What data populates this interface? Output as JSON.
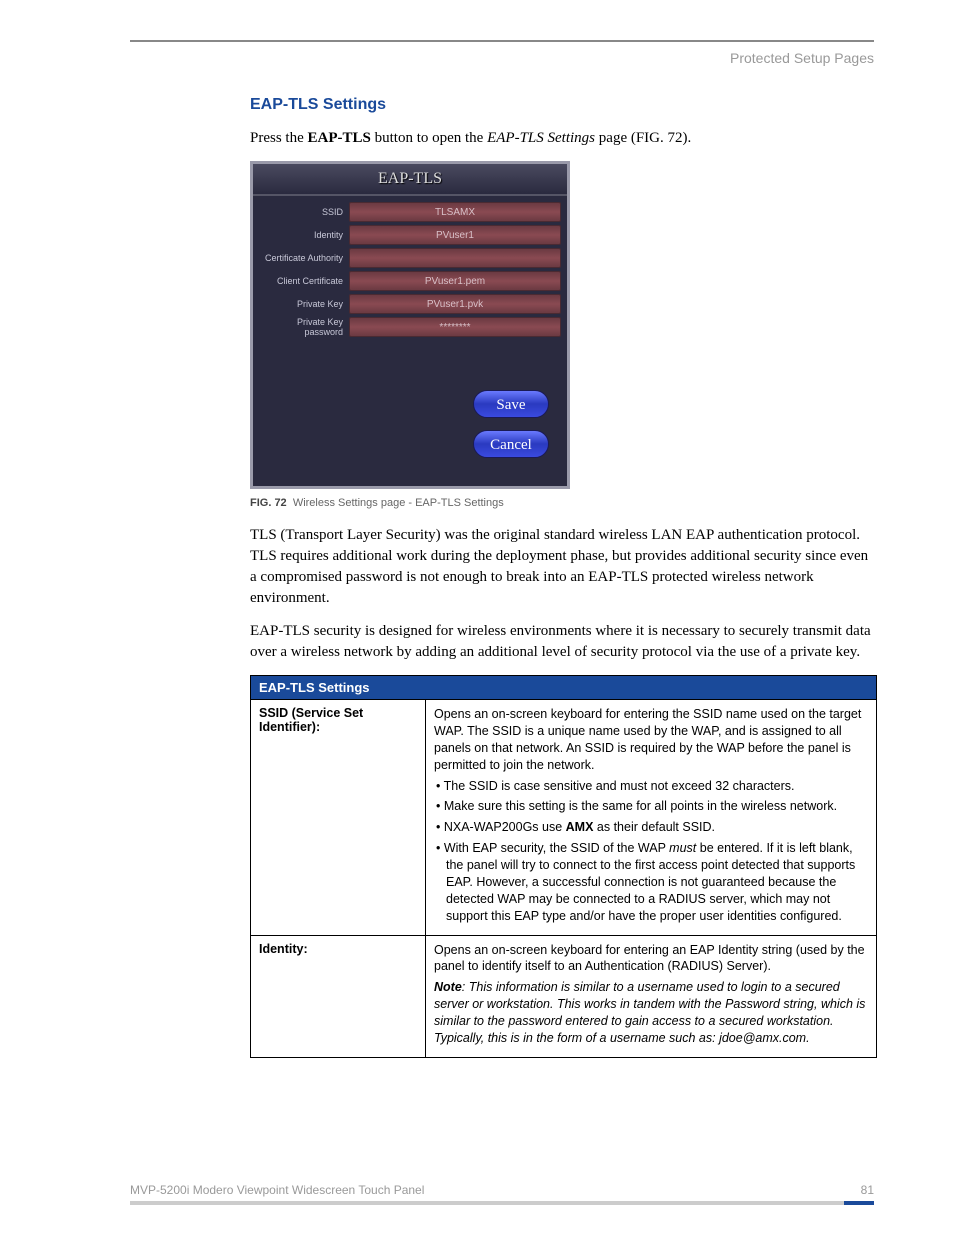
{
  "header": {
    "section": "Protected Setup Pages"
  },
  "section_title": "EAP-TLS Settings",
  "intro": {
    "prefix": "Press the ",
    "bold": "EAP-TLS",
    "mid": " button to open the ",
    "italic": "EAP-TLS Settings",
    "suffix": " page (FIG. 72)."
  },
  "ui": {
    "title": "EAP-TLS",
    "rows": [
      {
        "label": "SSID",
        "value": "TLSAMX"
      },
      {
        "label": "Identity",
        "value": "PVuser1"
      },
      {
        "label": "Certificate Authority",
        "value": ""
      },
      {
        "label": "Client Certificate",
        "value": "PVuser1.pem"
      },
      {
        "label": "Private Key",
        "value": "PVuser1.pvk"
      },
      {
        "label": "Private Key password",
        "value": "********"
      }
    ],
    "save": "Save",
    "cancel": "Cancel"
  },
  "fig": {
    "num": "FIG. 72",
    "caption": "Wireless Settings page - EAP-TLS Settings"
  },
  "para1": "TLS (Transport Layer Security) was the original standard wireless LAN EAP authentication protocol. TLS requires additional work during the deployment phase, but provides additional security since even a compromised password is not enough to break into an EAP-TLS protected wireless network environment.",
  "para2": "EAP-TLS security is designed for wireless environments where it is necessary to securely transmit data over a wireless network by adding an additional level of security protocol via the use of a private key.",
  "table": {
    "title": "EAP-TLS Settings",
    "row1": {
      "label": "SSID (Service Set Identifier):",
      "p1": "Opens an on-screen keyboard for entering the SSID name used on the target WAP. The SSID is a unique name used by the WAP, and is assigned to all panels on that network. An SSID is required by the WAP before the panel is permitted to join the network.",
      "b1": "• The SSID is case sensitive and must not exceed 32 characters.",
      "b2": "• Make sure this setting is the same for all points in the wireless network.",
      "b3_a": "• NXA-WAP200Gs use ",
      "b3_b": "AMX",
      "b3_c": " as their default SSID.",
      "b4_a": "• With EAP security, the SSID of the WAP ",
      "b4_b": "must",
      "b4_c": " be entered. If it is left blank, the panel will try to connect to the first access point detected that supports EAP. However, a successful connection is not guaranteed because the detected WAP may be connected to a RADIUS server, which may not support this EAP type and/or have the proper user identities configured."
    },
    "row2": {
      "label": "Identity:",
      "p1": "Opens an on-screen keyboard for entering an EAP Identity string (used by the panel to identify itself to an Authentication (RADIUS) Server).",
      "note_b": "Note",
      "note_t": ": This information is similar to a username used to login to a secured server or workstation. This works in tandem with the Password string, which is similar to the password entered to gain access to a secured workstation. Typically, this is in the form of a username such as: jdoe@amx.com."
    }
  },
  "footer": {
    "product": "MVP-5200i Modero Viewpoint Widescreen Touch Panel",
    "page": "81"
  }
}
